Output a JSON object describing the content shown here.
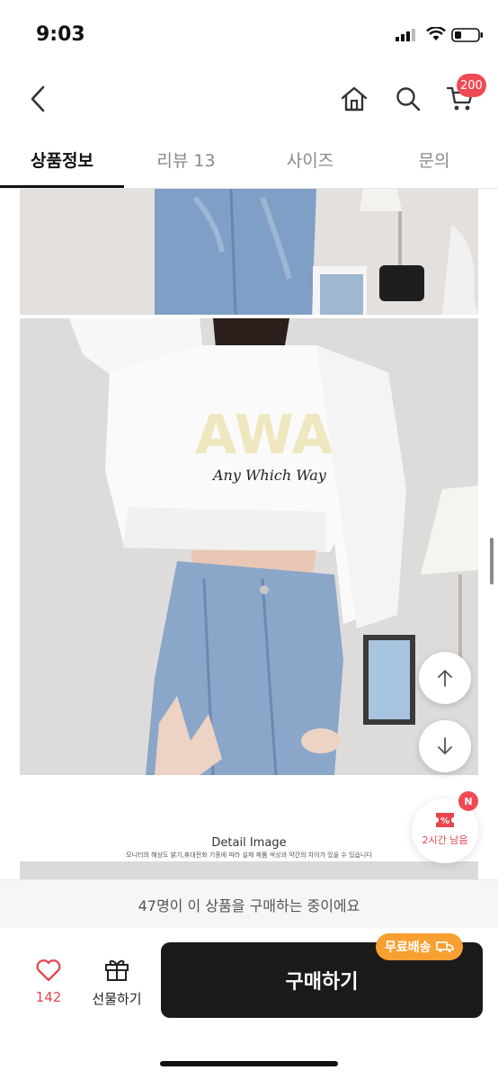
{
  "status_bar": {
    "time": "9:03"
  },
  "header": {
    "cart_count": "200"
  },
  "tabs": [
    {
      "label": "상품정보",
      "active": true
    },
    {
      "label": "리뷰 13",
      "active": false
    },
    {
      "label": "사이즈",
      "active": false
    },
    {
      "label": "문의",
      "active": false
    }
  ],
  "content": {
    "shirt_print": "AWA",
    "shirt_script": "Any Which Way",
    "detail_title": "Detail Image",
    "detail_subtitle": "모니터의 해상도 밝기,휴대전화 기종에 따라 실제 제품 색상과 약간의 차이가 있을 수 있습니다"
  },
  "coupon": {
    "badge": "N",
    "label": "2시간 남음"
  },
  "notice": {
    "text": "47명이 이 상품을 구매하는 중이에요"
  },
  "bottom_bar": {
    "like_count": "142",
    "gift_label": "선물하기",
    "buy_label": "구매하기",
    "shipping_badge": "무료배송"
  },
  "colors": {
    "accent_red": "#ef4a53",
    "shipping_orange": "#f7a031",
    "buy_button": "#1a1a1a"
  }
}
